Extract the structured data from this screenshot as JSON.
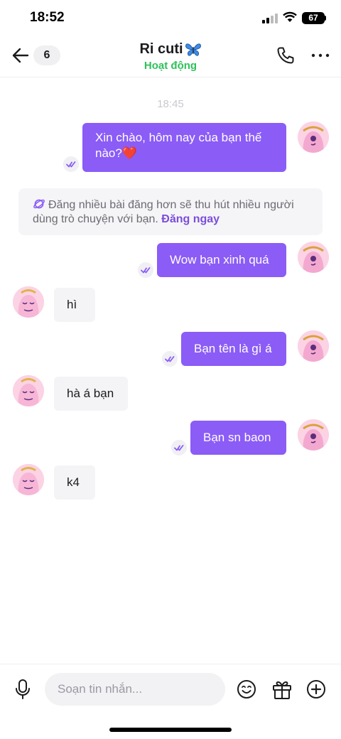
{
  "status_bar": {
    "time": "18:52",
    "battery": "67"
  },
  "header": {
    "unread_count": "6",
    "contact_name": "Ri cuti",
    "contact_status": "Hoạt động"
  },
  "timestamp": "18:45",
  "messages": [
    {
      "from": "me",
      "lines": [
        "Xin chào, hôm nay của bạn thế",
        "nào?❤️"
      ]
    },
    {
      "from": "me",
      "text": "Wow bạn xinh quá"
    },
    {
      "from": "them",
      "text": "hì"
    },
    {
      "from": "me",
      "text": "Bạn tên là gì á"
    },
    {
      "from": "them",
      "text": "hà á bạn"
    },
    {
      "from": "me",
      "text": "Bạn sn baon"
    },
    {
      "from": "them",
      "text": "k4"
    }
  ],
  "promo": {
    "text": "Đăng nhiều bài đăng hơn sẽ thu hút nhiều người dùng trò chuyện với bạn.",
    "link": "Đăng ngay"
  },
  "composer": {
    "placeholder": "Soạn tin nhắn..."
  },
  "colors": {
    "accent": "#8b5cf6",
    "online": "#2ec05a",
    "incoming_bubble": "#f4f4f6"
  },
  "icons": [
    "back-arrow-icon",
    "phone-icon",
    "more-icon",
    "butterfly-emoji",
    "planet-icon",
    "double-check-icon",
    "microphone-icon",
    "emoji-icon",
    "gift-icon",
    "plus-circle-icon"
  ]
}
